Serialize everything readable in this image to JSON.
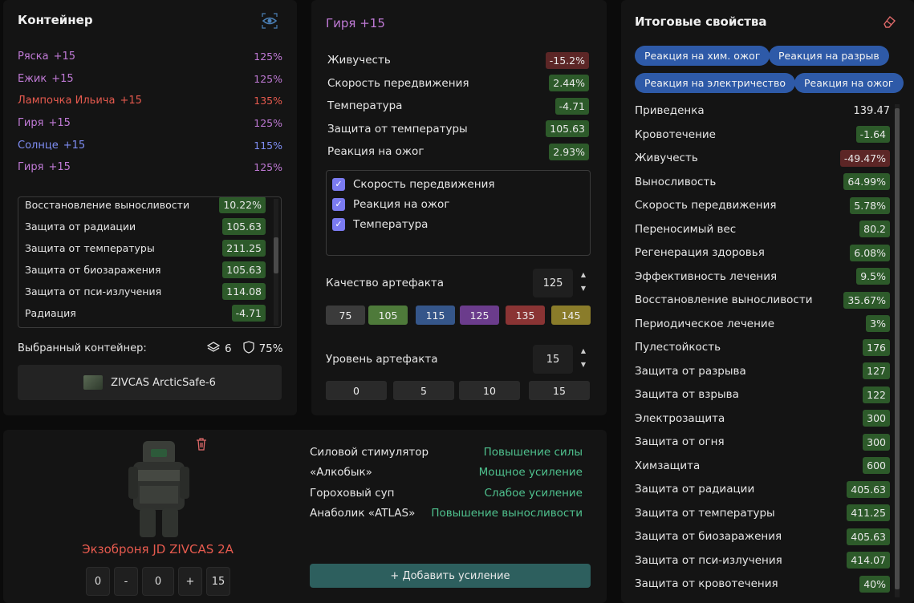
{
  "container": {
    "title": "Контейнер",
    "items": [
      {
        "name": "Ряска",
        "level": "+15",
        "pct": "125%",
        "color": "#c07ad6"
      },
      {
        "name": "Ежик",
        "level": "+15",
        "pct": "125%",
        "color": "#c07ad6"
      },
      {
        "name": "Лампочка Ильича",
        "level": "+15",
        "pct": "135%",
        "color": "#e65a4e"
      },
      {
        "name": "Гиря",
        "level": "+15",
        "pct": "125%",
        "color": "#c07ad6"
      },
      {
        "name": "Солнце",
        "level": "+15",
        "pct": "115%",
        "color": "#7f8ef5"
      },
      {
        "name": "Гиря",
        "level": "+15",
        "pct": "125%",
        "color": "#c07ad6"
      }
    ],
    "props": [
      {
        "name": "Восстановление выносливости",
        "value": "10.22%"
      },
      {
        "name": "Защита от радиации",
        "value": "105.63"
      },
      {
        "name": "Защита от температуры",
        "value": "211.25"
      },
      {
        "name": "Защита от биозаражения",
        "value": "105.63"
      },
      {
        "name": "Защита от пси-излучения",
        "value": "114.08"
      },
      {
        "name": "Радиация",
        "value": "-4.71"
      }
    ],
    "selected_label": "Выбранный контейнер:",
    "slots": "6",
    "protection": "75%",
    "selected_name": "ZIVCAS ArcticSafe-6"
  },
  "artifact": {
    "title": "Гиря +15",
    "props": [
      {
        "name": "Живучесть",
        "value": "-15.2%",
        "neg": true
      },
      {
        "name": "Скорость передвижения",
        "value": "2.44%",
        "neg": false
      },
      {
        "name": "Температура",
        "value": "-4.71",
        "neg": false
      },
      {
        "name": "Защита от температуры",
        "value": "105.63",
        "neg": false
      },
      {
        "name": "Реакция на ожог",
        "value": "2.93%",
        "neg": false
      }
    ],
    "checks": [
      "Скорость передвижения",
      "Реакция на ожог",
      "Температура"
    ],
    "quality_label": "Качество артефакта",
    "quality_value": "125",
    "quality_options": [
      {
        "label": "75",
        "color": "#3b3b3b"
      },
      {
        "label": "105",
        "color": "#4e7a3a"
      },
      {
        "label": "115",
        "color": "#35568a"
      },
      {
        "label": "125",
        "color": "#6b3c8c"
      },
      {
        "label": "135",
        "color": "#8a3434"
      },
      {
        "label": "145",
        "color": "#8a7c2a"
      }
    ],
    "level_label": "Уровень артефакта",
    "level_value": "15",
    "level_options": [
      "0",
      "5",
      "10",
      "15"
    ]
  },
  "totals": {
    "title": "Итоговые свойства",
    "tags": [
      "Реакция на хим. ожог",
      "Реакция на разрыв",
      "Реакция на электричество",
      "Реакция на ожог"
    ],
    "rows": [
      {
        "name": "Приведенка",
        "value": "139.47",
        "style": "plain"
      },
      {
        "name": "Кровотечение",
        "value": "-1.64",
        "style": "green"
      },
      {
        "name": "Живучесть",
        "value": "-49.47%",
        "style": "red"
      },
      {
        "name": "Выносливость",
        "value": "64.99%",
        "style": "green"
      },
      {
        "name": "Скорость передвижения",
        "value": "5.78%",
        "style": "green"
      },
      {
        "name": "Переносимый вес",
        "value": "80.2",
        "style": "green"
      },
      {
        "name": "Регенерация здоровья",
        "value": "6.08%",
        "style": "green"
      },
      {
        "name": "Эффективность лечения",
        "value": "9.5%",
        "style": "green"
      },
      {
        "name": "Восстановление выносливости",
        "value": "35.67%",
        "style": "green"
      },
      {
        "name": "Периодическое лечение",
        "value": "3%",
        "style": "green"
      },
      {
        "name": "Пулестойкость",
        "value": "176",
        "style": "green"
      },
      {
        "name": "Защита от разрыва",
        "value": "127",
        "style": "green"
      },
      {
        "name": "Защита от взрыва",
        "value": "122",
        "style": "green"
      },
      {
        "name": "Электрозащита",
        "value": "300",
        "style": "green"
      },
      {
        "name": "Защита от огня",
        "value": "300",
        "style": "green"
      },
      {
        "name": "Химзащита",
        "value": "600",
        "style": "green"
      },
      {
        "name": "Защита от радиации",
        "value": "405.63",
        "style": "green"
      },
      {
        "name": "Защита от температуры",
        "value": "411.25",
        "style": "green"
      },
      {
        "name": "Защита от биозаражения",
        "value": "405.63",
        "style": "green"
      },
      {
        "name": "Защита от пси-излучения",
        "value": "414.07",
        "style": "green"
      },
      {
        "name": "Защита от кровотечения",
        "value": "40%",
        "style": "green"
      }
    ]
  },
  "armor": {
    "name": "Экзоброня JD ZIVCAS 2A",
    "controls": [
      "0",
      "-",
      "0",
      "+",
      "15"
    ],
    "boosts": [
      {
        "name": "Силовой стимулятор",
        "effect": "Повышение силы"
      },
      {
        "name": "«Алкобык»",
        "effect": "Мощное усиление"
      },
      {
        "name": "Гороховый суп",
        "effect": "Слабое усиление"
      },
      {
        "name": "Анаболик «ATLAS»",
        "effect": "Повышение выносливости"
      }
    ],
    "add_button": "+ Добавить усиление"
  }
}
